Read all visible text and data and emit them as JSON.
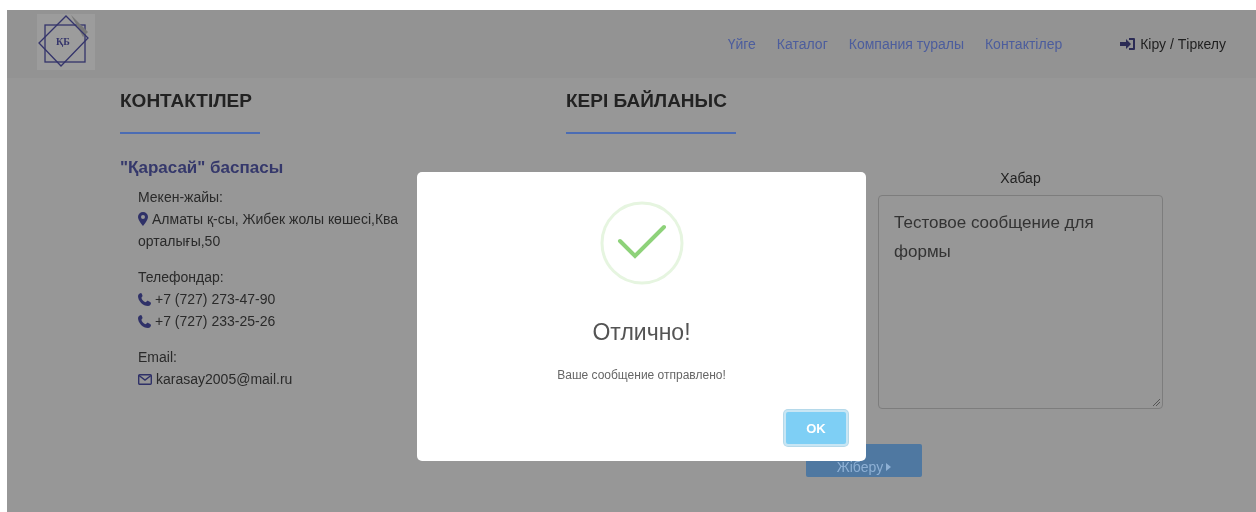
{
  "header": {
    "nav": [
      "Үйге",
      "Каталог",
      "Компания туралы",
      "Контактілер"
    ],
    "login": "Кіру / Тіркелу",
    "logo_text": "ҚБ"
  },
  "contacts": {
    "heading": "КОНТАКТІЛЕР",
    "company": "\"Қарасай\" баспасы",
    "address_label": "Мекен-жайы:",
    "address_lines": [
      "Алматы қ-сы, Жибек жолы көшесі,Ква",
      "орталығы,50"
    ],
    "phones_label": "Телефондар:",
    "phones": [
      "+7 (727) 273-47-90",
      "+7 (727) 233-25-26"
    ],
    "email_label": "Email:",
    "email": "karasay2005@mail.ru"
  },
  "feedback": {
    "heading": "КЕРІ БАЙЛАНЫС",
    "message_label": "Хабар",
    "message_value": "Тестовое сообщение для формы",
    "submit": "Жіберу"
  },
  "modal": {
    "title": "Отлично!",
    "text": "Ваше сообщение отправлено!",
    "ok": "OK"
  }
}
